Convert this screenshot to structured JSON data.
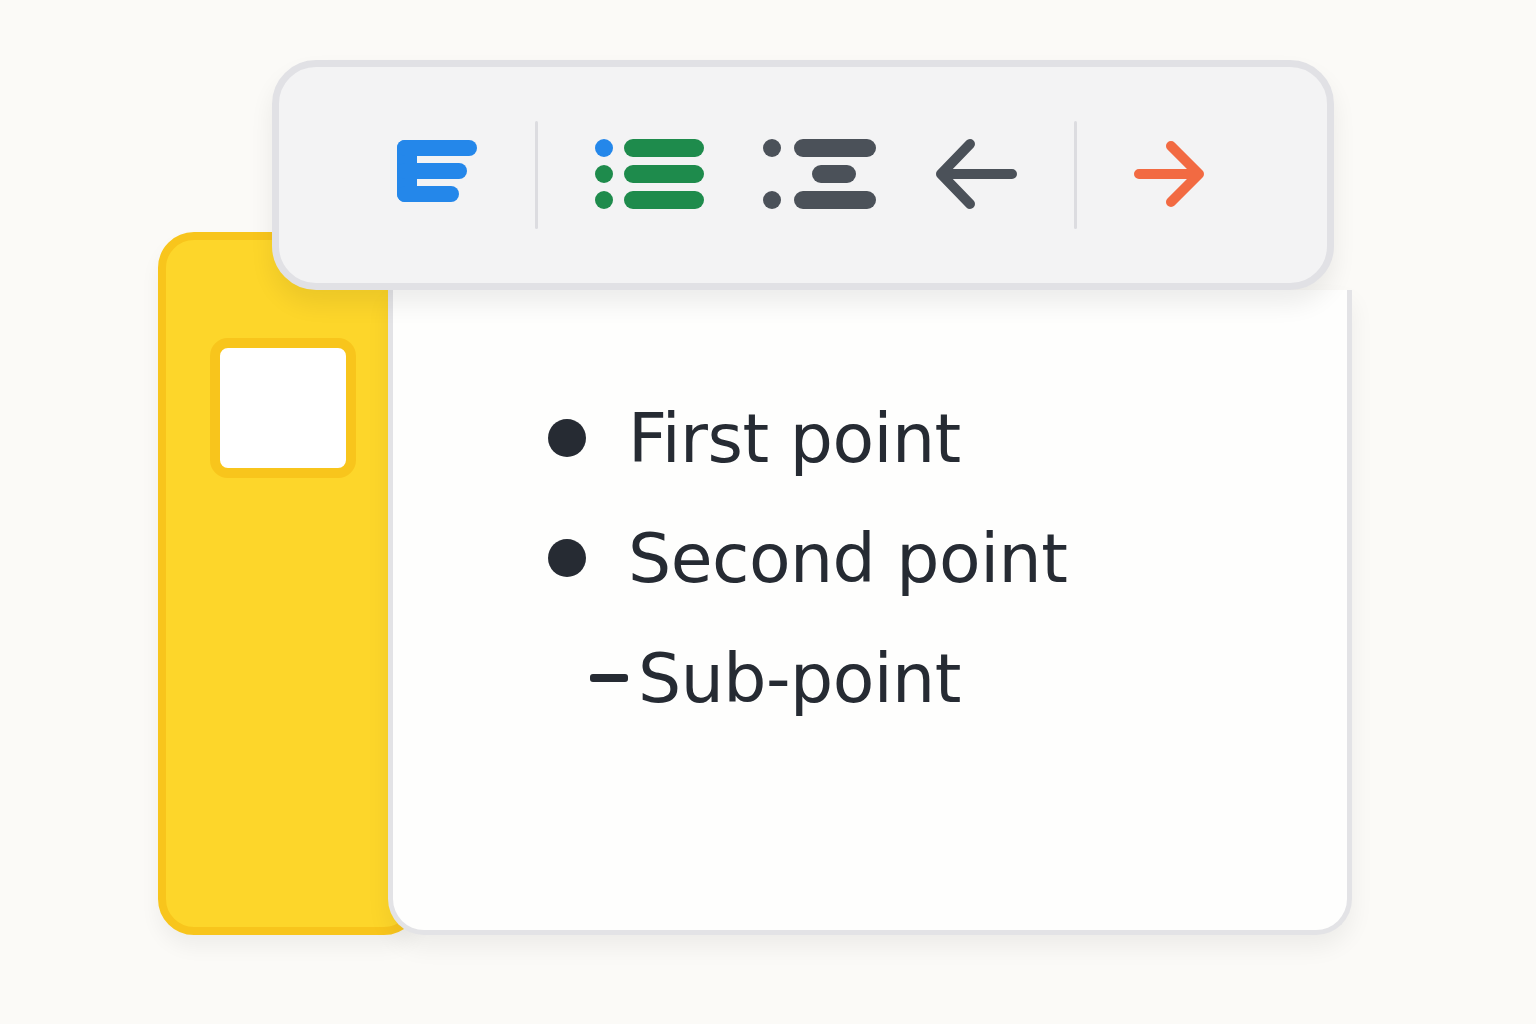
{
  "toolbar": {
    "items": [
      {
        "kind": "align"
      },
      {
        "kind": "divider"
      },
      {
        "kind": "bullets"
      },
      {
        "kind": "indent"
      },
      {
        "kind": "undo"
      },
      {
        "kind": "divider"
      },
      {
        "kind": "redo"
      }
    ]
  },
  "document": {
    "items": [
      {
        "text": "First point"
      },
      {
        "text": "Second point",
        "children": [
          {
            "text": "Sub-point"
          }
        ]
      }
    ]
  }
}
